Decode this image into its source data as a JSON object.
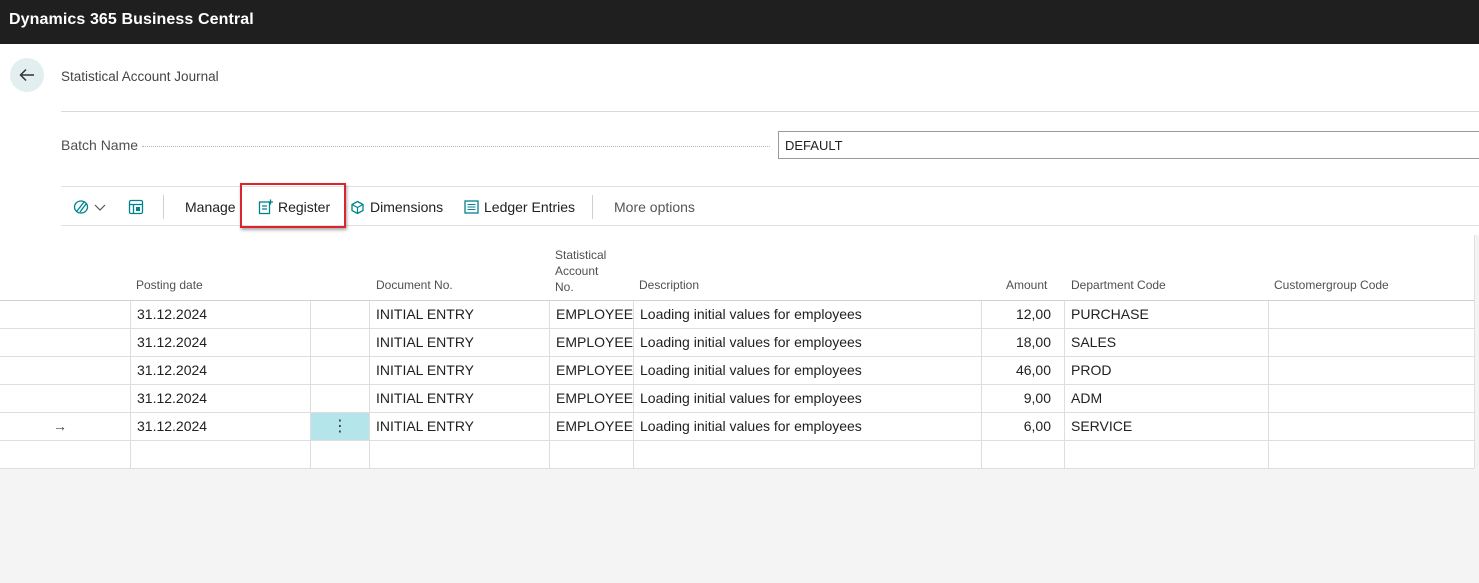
{
  "app": {
    "title": "Dynamics 365 Business Central"
  },
  "page": {
    "title": "Statistical Account Journal"
  },
  "batch": {
    "label": "Batch Name",
    "value": "DEFAULT"
  },
  "actions": {
    "manage": "Manage",
    "register": "Register",
    "dimensions": "Dimensions",
    "ledger_entries": "Ledger Entries",
    "more_options": "More options"
  },
  "grid": {
    "headers": {
      "posting_date": "Posting date",
      "document_no": "Document No.",
      "stat_account_no_1": "Statistical",
      "stat_account_no_2": "Account",
      "stat_account_no_3": "No.",
      "description": "Description",
      "amount": "Amount",
      "department_code": "Department Code",
      "customergroup_code": "Customergroup Code"
    },
    "rows": [
      {
        "posting_date": "31.12.2024",
        "document_no": "INITIAL ENTRY",
        "stat_account_no": "EMPLOYEES",
        "description": "Loading initial values for employees",
        "amount": "12,00",
        "department_code": "PURCHASE",
        "customergroup_code": ""
      },
      {
        "posting_date": "31.12.2024",
        "document_no": "INITIAL ENTRY",
        "stat_account_no": "EMPLOYEES",
        "description": "Loading initial values for employees",
        "amount": "18,00",
        "department_code": "SALES",
        "customergroup_code": ""
      },
      {
        "posting_date": "31.12.2024",
        "document_no": "INITIAL ENTRY",
        "stat_account_no": "EMPLOYEES",
        "description": "Loading initial values for employees",
        "amount": "46,00",
        "department_code": "PROD",
        "customergroup_code": ""
      },
      {
        "posting_date": "31.12.2024",
        "document_no": "INITIAL ENTRY",
        "stat_account_no": "EMPLOYEES",
        "description": "Loading initial values for employees",
        "amount": "9,00",
        "department_code": "ADM",
        "customergroup_code": ""
      },
      {
        "posting_date": "31.12.2024",
        "document_no": "INITIAL ENTRY",
        "stat_account_no": "EMPLOYEES",
        "description": "Loading initial values for employees",
        "amount": "6,00",
        "department_code": "SERVICE",
        "customergroup_code": "",
        "current_row_marker": "→",
        "row_menu": "⋮"
      },
      {
        "posting_date": "",
        "document_no": "",
        "stat_account_no": "",
        "description": "",
        "amount": "",
        "department_code": "",
        "customergroup_code": ""
      }
    ]
  },
  "colors": {
    "topbar": "#1f1f1f",
    "accent": "#00838f",
    "highlight_box": "#d9262e",
    "active_cell": "#b3e5ea"
  },
  "icons": {
    "back": "arrow-left-icon",
    "analyze": "copilot-analyze-icon",
    "edit_list": "edit-in-excel-icon",
    "register": "register-icon",
    "dimensions": "dimensions-icon",
    "ledger_entries": "ledger-entries-icon"
  }
}
